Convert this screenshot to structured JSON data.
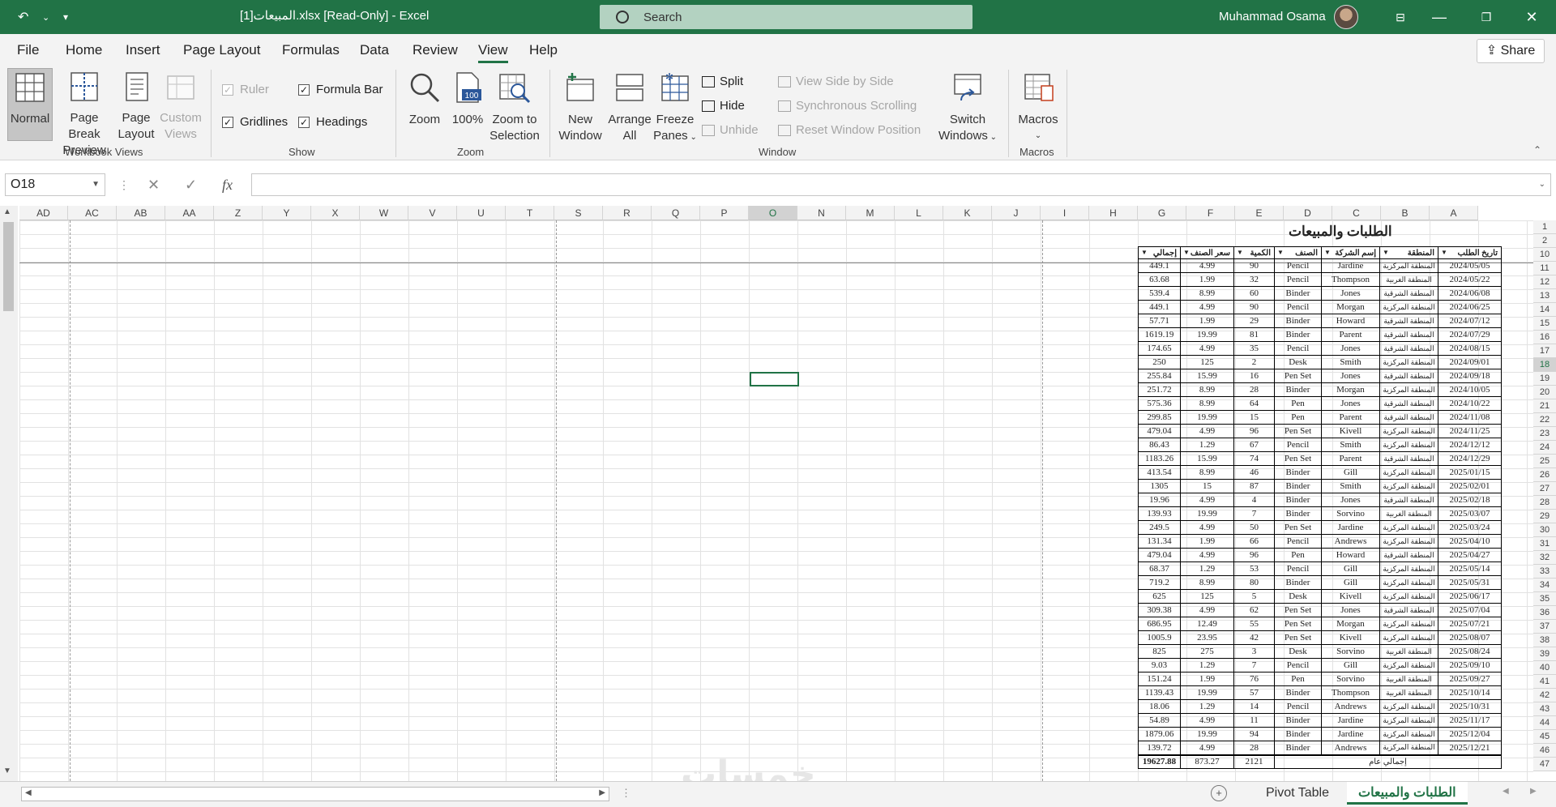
{
  "window": {
    "title": "المبيعات[1].xlsx  [Read-Only]  -  Excel",
    "search_placeholder": "Search",
    "user_name": "Muhammad Osama"
  },
  "menu": {
    "tabs": [
      "File",
      "Home",
      "Insert",
      "Page Layout",
      "Formulas",
      "Data",
      "Review",
      "View",
      "Help"
    ],
    "active_tab": "View",
    "share_label": "Share"
  },
  "ribbon": {
    "workbook_views": {
      "label": "Workbook Views",
      "normal": "Normal",
      "page_break_line1": "Page Break",
      "page_break_line2": "Preview",
      "page_layout_line1": "Page",
      "page_layout_line2": "Layout",
      "custom_views_line1": "Custom",
      "custom_views_line2": "Views"
    },
    "show": {
      "label": "Show",
      "ruler": "Ruler",
      "formula_bar": "Formula Bar",
      "gridlines": "Gridlines",
      "headings": "Headings"
    },
    "zoom": {
      "label": "Zoom",
      "zoom": "Zoom",
      "hundred": "100%",
      "zoom_sel_line1": "Zoom to",
      "zoom_sel_line2": "Selection"
    },
    "window": {
      "label": "Window",
      "new_window_line1": "New",
      "new_window_line2": "Window",
      "arrange_line1": "Arrange",
      "arrange_line2": "All",
      "freeze_line1": "Freeze",
      "freeze_line2": "Panes",
      "split": "Split",
      "hide": "Hide",
      "unhide": "Unhide",
      "side_by_side": "View Side by Side",
      "sync_scroll": "Synchronous Scrolling",
      "reset_pos": "Reset Window Position",
      "switch_line1": "Switch",
      "switch_line2": "Windows"
    },
    "macros": {
      "label": "Macros",
      "macros": "Macros"
    }
  },
  "formula_bar": {
    "name_box": "O18",
    "fx": "fx",
    "value": ""
  },
  "columns": [
    "AD",
    "AC",
    "AB",
    "AA",
    "Z",
    "Y",
    "X",
    "W",
    "V",
    "U",
    "T",
    "S",
    "R",
    "Q",
    "P",
    "O",
    "N",
    "M",
    "L",
    "K",
    "J",
    "I",
    "H",
    "G",
    "F",
    "E",
    "D",
    "C",
    "B",
    "A"
  ],
  "row_numbers": [
    "1",
    "2",
    "10",
    "11",
    "12",
    "13",
    "14",
    "15",
    "16",
    "17",
    "18",
    "19",
    "20",
    "21",
    "22",
    "23",
    "24",
    "25",
    "26",
    "27",
    "28",
    "29",
    "30",
    "31",
    "32",
    "33",
    "34",
    "35",
    "36",
    "37",
    "38",
    "39",
    "40",
    "41",
    "42",
    "43",
    "44",
    "45",
    "46",
    "47"
  ],
  "sheet": {
    "title": "الطلبات والمبيعات",
    "headers": [
      "إجمالي",
      "سعر الصنف",
      "الكمية",
      "الصنف",
      "إسم الشركة",
      "المنطقة",
      "تاريخ الطلب"
    ],
    "rows": [
      [
        "449.1",
        "4.99",
        "90",
        "Pencil",
        "Jardine",
        "المنطقة المركزية",
        "2024/05/05"
      ],
      [
        "63.68",
        "1.99",
        "32",
        "Pencil",
        "Thompson",
        "المنطقة الغربية",
        "2024/05/22"
      ],
      [
        "539.4",
        "8.99",
        "60",
        "Binder",
        "Jones",
        "المنطقة الشرقية",
        "2024/06/08"
      ],
      [
        "449.1",
        "4.99",
        "90",
        "Pencil",
        "Morgan",
        "المنطقة المركزية",
        "2024/06/25"
      ],
      [
        "57.71",
        "1.99",
        "29",
        "Binder",
        "Howard",
        "المنطقة الشرقية",
        "2024/07/12"
      ],
      [
        "1619.19",
        "19.99",
        "81",
        "Binder",
        "Parent",
        "المنطقة الشرقية",
        "2024/07/29"
      ],
      [
        "174.65",
        "4.99",
        "35",
        "Pencil",
        "Jones",
        "المنطقة الشرقية",
        "2024/08/15"
      ],
      [
        "250",
        "125",
        "2",
        "Desk",
        "Smith",
        "المنطقة المركزية",
        "2024/09/01"
      ],
      [
        "255.84",
        "15.99",
        "16",
        "Pen Set",
        "Jones",
        "المنطقة الشرقية",
        "2024/09/18"
      ],
      [
        "251.72",
        "8.99",
        "28",
        "Binder",
        "Morgan",
        "المنطقة المركزية",
        "2024/10/05"
      ],
      [
        "575.36",
        "8.99",
        "64",
        "Pen",
        "Jones",
        "المنطقة الشرقية",
        "2024/10/22"
      ],
      [
        "299.85",
        "19.99",
        "15",
        "Pen",
        "Parent",
        "المنطقة الشرقية",
        "2024/11/08"
      ],
      [
        "479.04",
        "4.99",
        "96",
        "Pen Set",
        "Kivell",
        "المنطقة المركزية",
        "2024/11/25"
      ],
      [
        "86.43",
        "1.29",
        "67",
        "Pencil",
        "Smith",
        "المنطقة المركزية",
        "2024/12/12"
      ],
      [
        "1183.26",
        "15.99",
        "74",
        "Pen Set",
        "Parent",
        "المنطقة الشرقية",
        "2024/12/29"
      ],
      [
        "413.54",
        "8.99",
        "46",
        "Binder",
        "Gill",
        "المنطقة المركزية",
        "2025/01/15"
      ],
      [
        "1305",
        "15",
        "87",
        "Binder",
        "Smith",
        "المنطقة المركزية",
        "2025/02/01"
      ],
      [
        "19.96",
        "4.99",
        "4",
        "Binder",
        "Jones",
        "المنطقة الشرقية",
        "2025/02/18"
      ],
      [
        "139.93",
        "19.99",
        "7",
        "Binder",
        "Sorvino",
        "المنطقة الغربية",
        "2025/03/07"
      ],
      [
        "249.5",
        "4.99",
        "50",
        "Pen Set",
        "Jardine",
        "المنطقة المركزية",
        "2025/03/24"
      ],
      [
        "131.34",
        "1.99",
        "66",
        "Pencil",
        "Andrews",
        "المنطقة المركزية",
        "2025/04/10"
      ],
      [
        "479.04",
        "4.99",
        "96",
        "Pen",
        "Howard",
        "المنطقة الشرقية",
        "2025/04/27"
      ],
      [
        "68.37",
        "1.29",
        "53",
        "Pencil",
        "Gill",
        "المنطقة المركزية",
        "2025/05/14"
      ],
      [
        "719.2",
        "8.99",
        "80",
        "Binder",
        "Gill",
        "المنطقة المركزية",
        "2025/05/31"
      ],
      [
        "625",
        "125",
        "5",
        "Desk",
        "Kivell",
        "المنطقة المركزية",
        "2025/06/17"
      ],
      [
        "309.38",
        "4.99",
        "62",
        "Pen Set",
        "Jones",
        "المنطقة الشرقية",
        "2025/07/04"
      ],
      [
        "686.95",
        "12.49",
        "55",
        "Pen Set",
        "Morgan",
        "المنطقة المركزية",
        "2025/07/21"
      ],
      [
        "1005.9",
        "23.95",
        "42",
        "Pen Set",
        "Kivell",
        "المنطقة المركزية",
        "2025/08/07"
      ],
      [
        "825",
        "275",
        "3",
        "Desk",
        "Sorvino",
        "المنطقة الغربية",
        "2025/08/24"
      ],
      [
        "9.03",
        "1.29",
        "7",
        "Pencil",
        "Gill",
        "المنطقة المركزية",
        "2025/09/10"
      ],
      [
        "151.24",
        "1.99",
        "76",
        "Pen",
        "Sorvino",
        "المنطقة الغربية",
        "2025/09/27"
      ],
      [
        "1139.43",
        "19.99",
        "57",
        "Binder",
        "Thompson",
        "المنطقة الغربية",
        "2025/10/14"
      ],
      [
        "18.06",
        "1.29",
        "14",
        "Pencil",
        "Andrews",
        "المنطقة المركزية",
        "2025/10/31"
      ],
      [
        "54.89",
        "4.99",
        "11",
        "Binder",
        "Jardine",
        "المنطقة المركزية",
        "2025/11/17"
      ],
      [
        "1879.06",
        "19.99",
        "94",
        "Binder",
        "Jardine",
        "المنطقة المركزية",
        "2025/12/04"
      ],
      [
        "139.72",
        "4.99",
        "28",
        "Binder",
        "Andrews",
        "المنطقة المركزية",
        "2025/12/21"
      ]
    ],
    "total": {
      "sum_total": "19627.88",
      "sum_price": "873.27",
      "sum_qty": "2121",
      "label": "إجمالي عام"
    }
  },
  "tabs": {
    "pivot": "Pivot Table",
    "main": "الطلبات والمبيعات"
  },
  "watermark": "خمسات",
  "colors": {
    "brand": "#217346",
    "ribbon_bg": "#f3f3f3"
  }
}
